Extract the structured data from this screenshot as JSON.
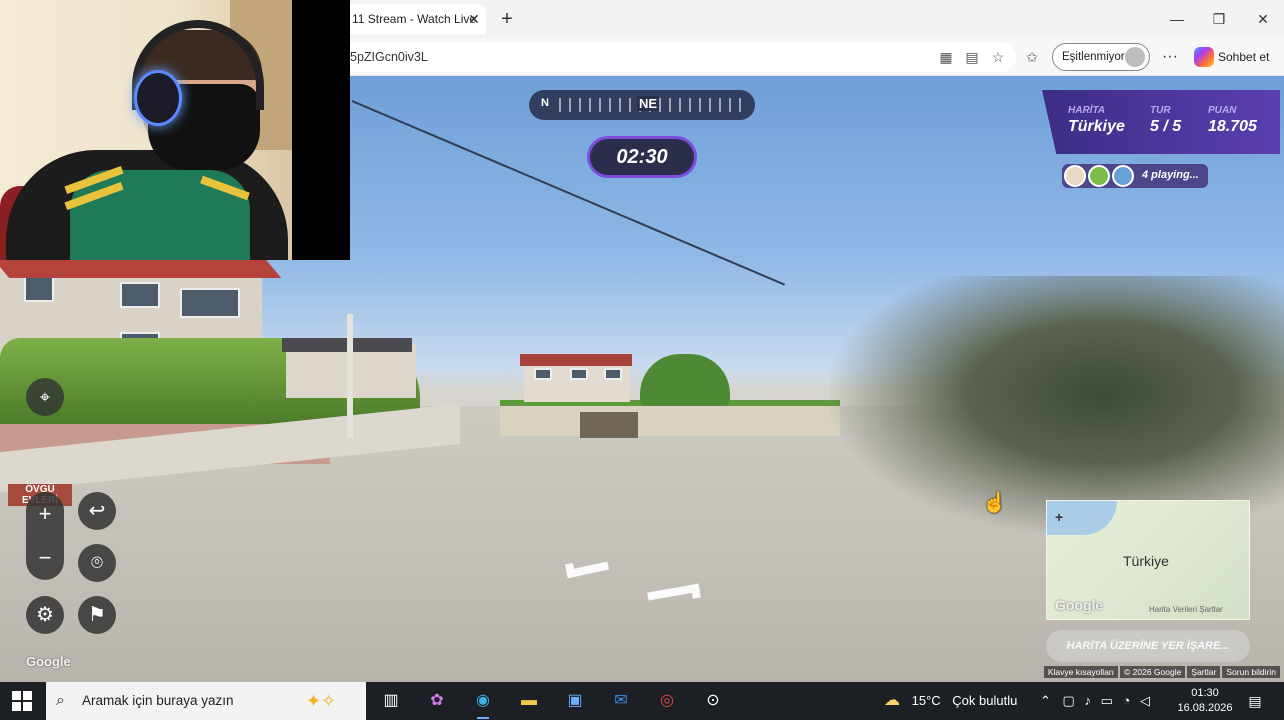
{
  "browser": {
    "tab_title": "11 Stream - Watch Live",
    "tab_close": "✕",
    "new_tab": "+",
    "url": "5pZIGcn0iv3L",
    "sync_label": "Eşitlenmiyor",
    "more": "···",
    "copilot_label": "Sohbet et",
    "window_controls": {
      "minimize": "—",
      "maximize": "❐",
      "close": "✕"
    }
  },
  "game": {
    "compass": {
      "n": "N",
      "heading": "NE"
    },
    "timer": "02:30",
    "score": {
      "map_label": "HARİTA",
      "map_value": "Türkiye",
      "round_label": "TUR",
      "round_value": "5 / 5",
      "points_label": "PUAN",
      "points_value": "18.705"
    },
    "players_text": "4 playing...",
    "controls": {
      "zoom_in": "+",
      "zoom_out": "−",
      "back": "↩",
      "checkpoint": "⌾",
      "settings": "⚙",
      "flag": "⚑"
    },
    "minimap": {
      "country_label": "Türkiye",
      "plus": "+",
      "google": "Google",
      "terms": "Harita Verileri   Şartlar"
    },
    "guess_button": "HARİTA ÜZERİNE YER İŞARE...",
    "google_watermark": "Google",
    "sign_text": "ÖVGÜ EVLERİ",
    "attribution": [
      "Klavye kısayolları",
      "© 2026 Google",
      "Şartlar",
      "Sorun bildirin"
    ]
  },
  "taskbar": {
    "search_placeholder": "Aramak için buraya yazın",
    "weather_temp": "15°C",
    "weather_text": "Çok bulutlu",
    "time": "01:30",
    "date": "16.08.2026"
  }
}
